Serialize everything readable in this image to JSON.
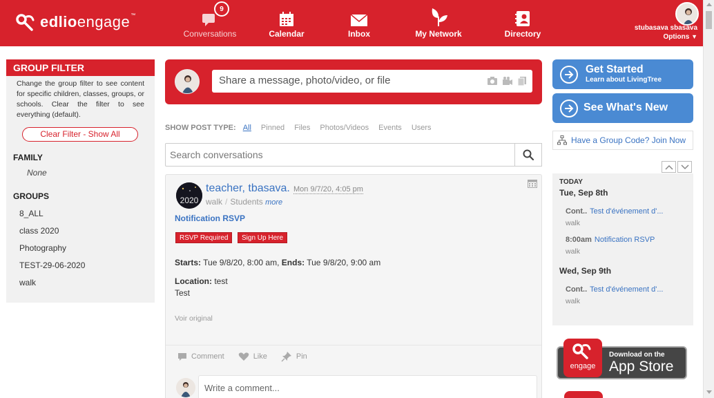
{
  "app": {
    "logo_bold": "edlio",
    "logo_light": "engage",
    "tm": "™"
  },
  "nav": {
    "items": [
      {
        "label": "Conversations",
        "icon": "chat-bubble-icon",
        "badge": "9"
      },
      {
        "label": "Calendar",
        "icon": "calendar-icon"
      },
      {
        "label": "Inbox",
        "icon": "envelope-icon"
      },
      {
        "label": "My Network",
        "icon": "leaf-icon"
      },
      {
        "label": "Directory",
        "icon": "directory-icon"
      }
    ]
  },
  "user": {
    "name": "stubasava sbasava",
    "options": "Options"
  },
  "left": {
    "header": "GROUP FILTER",
    "description": "Change the group filter to see content for specific children, classes, groups, or schools. Clear the filter to see everything (default).",
    "clear_button": "Clear Filter - Show All",
    "family_title": "FAMILY",
    "family_value": "None",
    "groups_title": "GROUPS",
    "groups": [
      "8_ALL",
      "class 2020",
      "Photography",
      "TEST-29-06-2020",
      "walk"
    ]
  },
  "share": {
    "placeholder": "Share a message, photo/video, or file"
  },
  "post_types": {
    "label": "SHOW POST TYPE:",
    "items": [
      "All",
      "Pinned",
      "Files",
      "Photos/Videos",
      "Events",
      "Users"
    ],
    "active": "All"
  },
  "search": {
    "placeholder": "Search conversations"
  },
  "post": {
    "author": "teacher, tbasava.",
    "date": "Mon 9/7/20, 4:05 pm",
    "group": "walk",
    "audience": "Students",
    "more": "more",
    "avatar_text": "2020",
    "title": "Notification RSVP",
    "tags": [
      "RSVP Required",
      "Sign Up Here"
    ],
    "starts_label": "Starts:",
    "starts_value": "Tue 9/8/20, 8:00 am,",
    "ends_label": "Ends:",
    "ends_value": "Tue 9/8/20, 9:00 am",
    "location_label": "Location:",
    "location_value": "test",
    "body": "Test",
    "voir": "Voir original",
    "actions": [
      "Comment",
      "Like",
      "Pin"
    ],
    "comment_placeholder": "Write a comment..."
  },
  "right": {
    "get_started_title": "Get Started",
    "get_started_sub": "Learn about LivingTree",
    "whats_new": "See What's New",
    "group_code": "Have a Group Code? Join Now",
    "today": "TODAY",
    "days": [
      {
        "label": "Tue, Sep 8th",
        "events": [
          {
            "time": "Cont..",
            "title": "Test d'événement d'...",
            "group": "walk"
          },
          {
            "time": "8:00am",
            "title": "Notification RSVP",
            "group": "walk"
          }
        ]
      },
      {
        "label": "Wed, Sep 9th",
        "events": [
          {
            "time": "Cont..",
            "title": "Test d'événement d'...",
            "group": "walk"
          }
        ]
      }
    ],
    "appstore_small": "Download on the",
    "appstore_big": "App Store",
    "appstore_icon_text": "engage"
  },
  "colors": {
    "brand_red": "#d7222c",
    "link_blue": "#3a73c2",
    "button_blue": "#4a8ad3"
  }
}
